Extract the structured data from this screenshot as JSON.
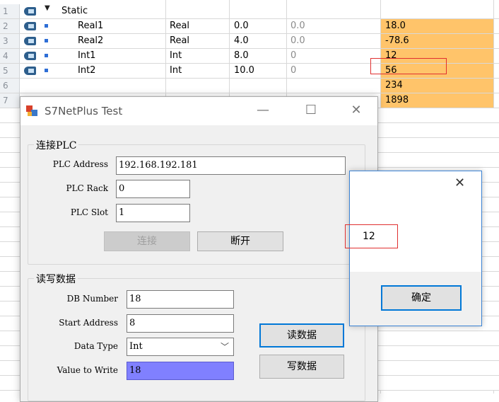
{
  "table": {
    "rows": [
      {
        "num": "1",
        "name": "Static",
        "type": "",
        "start": "",
        "snapshot": "",
        "monitor": "",
        "kind": "struct"
      },
      {
        "num": "2",
        "name": "Real1",
        "type": "Real",
        "start": "0.0",
        "snapshot": "0.0",
        "monitor": "18.0",
        "kind": "var"
      },
      {
        "num": "3",
        "name": "Real2",
        "type": "Real",
        "start": "4.0",
        "snapshot": "0.0",
        "monitor": "-78.6",
        "kind": "var"
      },
      {
        "num": "4",
        "name": "Int1",
        "type": "Int",
        "start": "8.0",
        "snapshot": "0",
        "monitor": "12",
        "kind": "var"
      },
      {
        "num": "5",
        "name": "Int2",
        "type": "Int",
        "start": "10.0",
        "snapshot": "0",
        "monitor": "56",
        "kind": "var"
      },
      {
        "num": "6",
        "name": "",
        "type": "",
        "start": "",
        "snapshot": "",
        "monitor": "234",
        "kind": "hidden"
      },
      {
        "num": "7",
        "name": "",
        "type": "",
        "start": "",
        "snapshot": "",
        "monitor": "1898",
        "kind": "hidden"
      }
    ],
    "monitor_color": "#ffc46a",
    "io_icon": "db-io-icon",
    "expand_icon": "triangle-down-icon"
  },
  "window": {
    "title": "S7NetPlus Test",
    "minimize": "—",
    "maximize": "☐",
    "close": "✕",
    "connect_group": {
      "legend": "连接PLC",
      "address_label": "PLC Address",
      "address_value": "192.168.192.181",
      "rack_label": "PLC Rack",
      "rack_value": "0",
      "slot_label": "PLC Slot",
      "slot_value": "1",
      "connect_button": "连接",
      "disconnect_button": "断开"
    },
    "rw_group": {
      "legend": "读写数据",
      "db_label": "DB Number",
      "db_value": "18",
      "start_label": "Start Address",
      "start_value": "8",
      "type_label": "Data Type",
      "type_value": "Int",
      "value_label": "Value to Write",
      "value_value": "18",
      "read_button": "读数据",
      "write_button": "写数据"
    }
  },
  "message_box": {
    "close": "✕",
    "text": "12",
    "ok_button": "确定"
  }
}
